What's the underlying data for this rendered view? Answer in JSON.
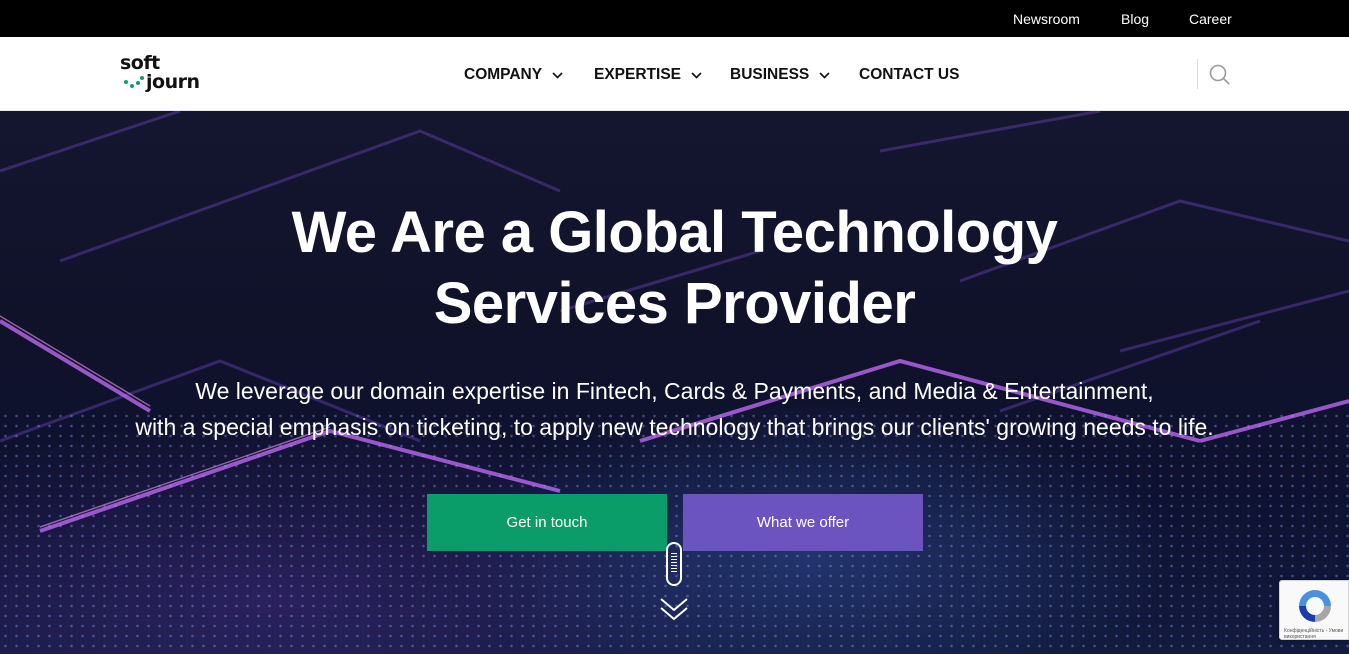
{
  "topbar": {
    "links": [
      "Newsroom",
      "Blog",
      "Career"
    ]
  },
  "header": {
    "logo": {
      "line1": "soft",
      "line2": "journ",
      "dot_color": "#129b66"
    },
    "nav": [
      {
        "label": "COMPANY",
        "has_dropdown": true
      },
      {
        "label": "EXPERTISE",
        "has_dropdown": true
      },
      {
        "label": "BUSINESS",
        "has_dropdown": true
      },
      {
        "label": "CONTACT US",
        "has_dropdown": false
      }
    ],
    "search_icon": "search-icon"
  },
  "hero": {
    "title_line1": "We Are a Global Technology",
    "title_line2": "Services Provider",
    "subtitle_line1": "We leverage our domain expertise in Fintech, Cards & Payments, and Media & Entertainment,",
    "subtitle_line2": "with a special emphasis on ticketing, to apply new technology that brings our clients' growing needs to life.",
    "buttons": {
      "primary": {
        "label": "Get in touch",
        "color": "#0a9d6a"
      },
      "secondary": {
        "label": "What we offer",
        "color": "#6b54c0"
      }
    },
    "scroll_icon": "mouse-scroll-icon",
    "arrow_icon": "double-chevron-down-icon"
  },
  "recaptcha": {
    "text_line1": "Конфіденційність - Умови",
    "text_line2": "використання"
  },
  "colors": {
    "topbar_bg": "#000000",
    "header_bg": "#ffffff",
    "accent_green": "#0a9d6a",
    "accent_purple": "#6b54c0"
  }
}
